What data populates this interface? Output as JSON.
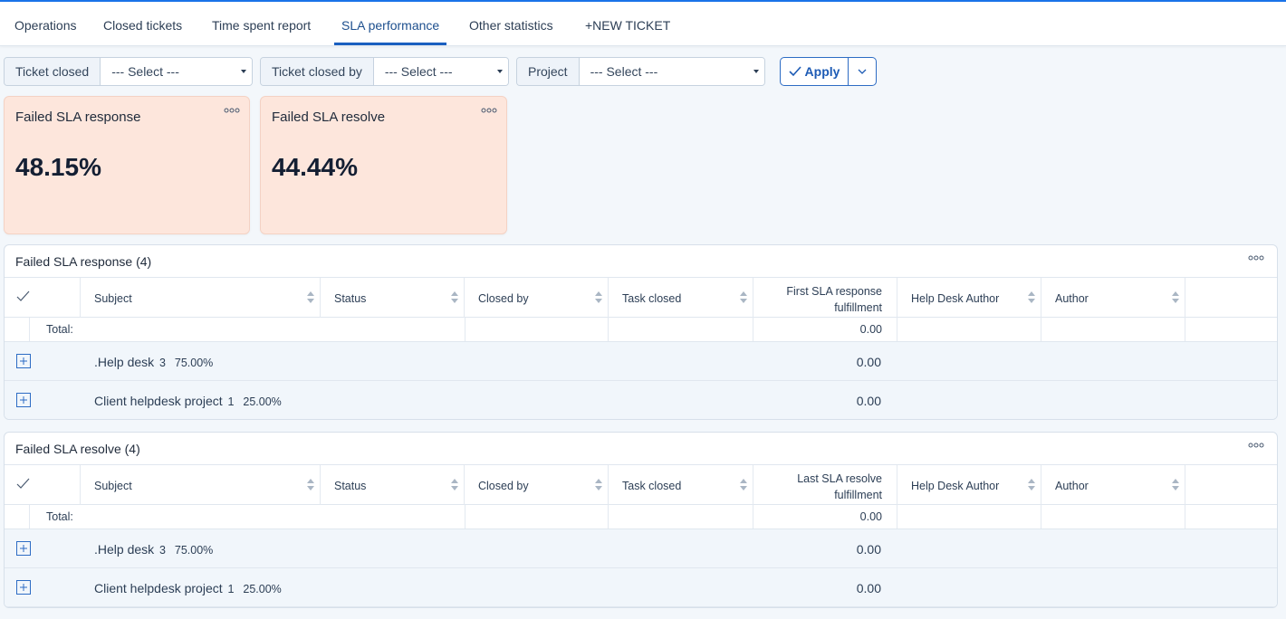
{
  "tabs": [
    {
      "label": "Operations"
    },
    {
      "label": "Closed tickets"
    },
    {
      "label": "Time spent report"
    },
    {
      "label": "SLA performance"
    },
    {
      "label": "Other statistics"
    },
    {
      "label": "+NEW TICKET"
    }
  ],
  "filters": [
    {
      "label": "Ticket closed",
      "value": "--- Select ---"
    },
    {
      "label": "Ticket closed by",
      "value": "--- Select ---"
    },
    {
      "label": "Project",
      "value": "--- Select ---"
    }
  ],
  "apply_label": "Apply",
  "cards": [
    {
      "title": "Failed SLA response",
      "value": "48.15%"
    },
    {
      "title": "Failed SLA resolve",
      "value": "44.44%"
    }
  ],
  "tables": [
    {
      "title": "Failed SLA response (4)",
      "columns": {
        "subject": "Subject",
        "status": "Status",
        "closed_by": "Closed by",
        "task_closed": "Task closed",
        "fulfillment_line1": "First SLA response",
        "fulfillment_line2": "fulfillment",
        "help_desk_author": "Help Desk Author",
        "author": "Author"
      },
      "total_label": "Total:",
      "total_value": "0.00",
      "groups": [
        {
          "name": ".Help desk",
          "count": "3",
          "percent": "75.00%",
          "value": "0.00"
        },
        {
          "name": "Client helpdesk project",
          "count": "1",
          "percent": "25.00%",
          "value": "0.00"
        }
      ]
    },
    {
      "title": "Failed SLA resolve (4)",
      "columns": {
        "subject": "Subject",
        "status": "Status",
        "closed_by": "Closed by",
        "task_closed": "Task closed",
        "fulfillment_line1": "Last SLA resolve",
        "fulfillment_line2": "fulfillment",
        "help_desk_author": "Help Desk Author",
        "author": "Author"
      },
      "total_label": "Total:",
      "total_value": "0.00",
      "groups": [
        {
          "name": ".Help desk",
          "count": "3",
          "percent": "75.00%",
          "value": "0.00"
        },
        {
          "name": "Client helpdesk project",
          "count": "1",
          "percent": "25.00%",
          "value": "0.00"
        }
      ]
    }
  ],
  "colors": {
    "accent": "#1a73e8",
    "card_bg": "#fde6dc",
    "primary_text": "#1f2a3a"
  },
  "icons": {
    "apply": "check-icon",
    "more": "more-options-icon",
    "expand": "plus-square-icon",
    "select_all": "check-icon"
  }
}
